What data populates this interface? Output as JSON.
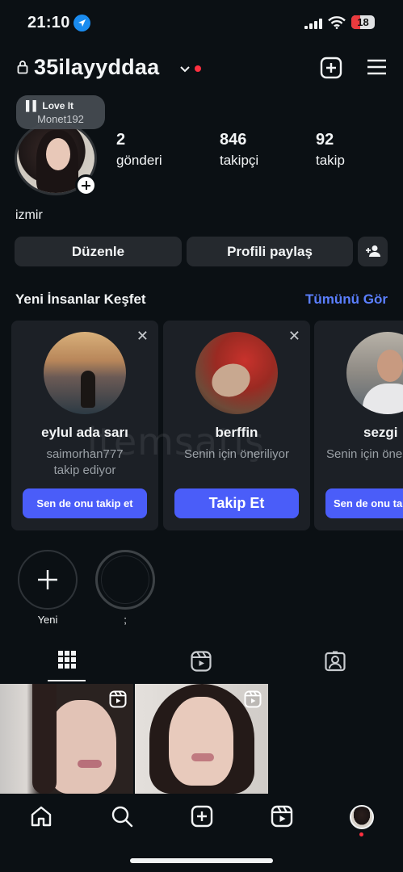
{
  "status_bar": {
    "time": "21:10",
    "battery": "18"
  },
  "header": {
    "username": "35ilayyddaa",
    "icons": [
      "lock-icon",
      "chevron-down-icon",
      "new-post-icon",
      "menu-icon"
    ]
  },
  "note": {
    "title": "Love It",
    "artist": "Monet192"
  },
  "stats": [
    {
      "value": "2",
      "label": "gönderi"
    },
    {
      "value": "846",
      "label": "takipçi"
    },
    {
      "value": "92",
      "label": "takip"
    }
  ],
  "bio": "izmir",
  "actions": {
    "edit": "Düzenle",
    "share": "Profili paylaş"
  },
  "discover": {
    "title": "Yeni İnsanlar Keşfet",
    "see_all": "Tümünü Gör",
    "cards": [
      {
        "name": "eylul ada sarı",
        "sub_line1": "saimorhan777",
        "sub_line2": "takip ediyor",
        "cta": "Sen de onu takip et"
      },
      {
        "name": "berffin",
        "sub_line1": "Senin için öneriliyor",
        "sub_line2": "",
        "cta": "Takip Et"
      },
      {
        "name": "sezgi",
        "sub_line1": "Senin için öneriliyor",
        "sub_line2": "",
        "cta": "Sen de onu takip et"
      }
    ]
  },
  "highlights": [
    {
      "label": "Yeni"
    },
    {
      "label": ";"
    }
  ],
  "watermark": "itemsatış",
  "accent_color": "#4a5df9",
  "link_color": "#5b7fff"
}
